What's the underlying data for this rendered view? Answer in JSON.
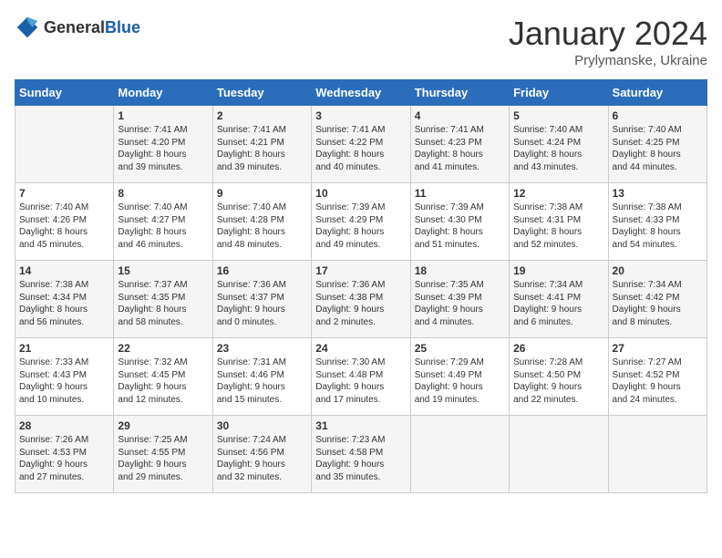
{
  "header": {
    "logo_general": "General",
    "logo_blue": "Blue",
    "month_title": "January 2024",
    "subtitle": "Prylymanske, Ukraine"
  },
  "weekdays": [
    "Sunday",
    "Monday",
    "Tuesday",
    "Wednesday",
    "Thursday",
    "Friday",
    "Saturday"
  ],
  "weeks": [
    [
      {
        "day": "",
        "content": ""
      },
      {
        "day": "1",
        "content": "Sunrise: 7:41 AM\nSunset: 4:20 PM\nDaylight: 8 hours\nand 39 minutes."
      },
      {
        "day": "2",
        "content": "Sunrise: 7:41 AM\nSunset: 4:21 PM\nDaylight: 8 hours\nand 39 minutes."
      },
      {
        "day": "3",
        "content": "Sunrise: 7:41 AM\nSunset: 4:22 PM\nDaylight: 8 hours\nand 40 minutes."
      },
      {
        "day": "4",
        "content": "Sunrise: 7:41 AM\nSunset: 4:23 PM\nDaylight: 8 hours\nand 41 minutes."
      },
      {
        "day": "5",
        "content": "Sunrise: 7:40 AM\nSunset: 4:24 PM\nDaylight: 8 hours\nand 43 minutes."
      },
      {
        "day": "6",
        "content": "Sunrise: 7:40 AM\nSunset: 4:25 PM\nDaylight: 8 hours\nand 44 minutes."
      }
    ],
    [
      {
        "day": "7",
        "content": "Sunrise: 7:40 AM\nSunset: 4:26 PM\nDaylight: 8 hours\nand 45 minutes."
      },
      {
        "day": "8",
        "content": "Sunrise: 7:40 AM\nSunset: 4:27 PM\nDaylight: 8 hours\nand 46 minutes."
      },
      {
        "day": "9",
        "content": "Sunrise: 7:40 AM\nSunset: 4:28 PM\nDaylight: 8 hours\nand 48 minutes."
      },
      {
        "day": "10",
        "content": "Sunrise: 7:39 AM\nSunset: 4:29 PM\nDaylight: 8 hours\nand 49 minutes."
      },
      {
        "day": "11",
        "content": "Sunrise: 7:39 AM\nSunset: 4:30 PM\nDaylight: 8 hours\nand 51 minutes."
      },
      {
        "day": "12",
        "content": "Sunrise: 7:38 AM\nSunset: 4:31 PM\nDaylight: 8 hours\nand 52 minutes."
      },
      {
        "day": "13",
        "content": "Sunrise: 7:38 AM\nSunset: 4:33 PM\nDaylight: 8 hours\nand 54 minutes."
      }
    ],
    [
      {
        "day": "14",
        "content": "Sunrise: 7:38 AM\nSunset: 4:34 PM\nDaylight: 8 hours\nand 56 minutes."
      },
      {
        "day": "15",
        "content": "Sunrise: 7:37 AM\nSunset: 4:35 PM\nDaylight: 8 hours\nand 58 minutes."
      },
      {
        "day": "16",
        "content": "Sunrise: 7:36 AM\nSunset: 4:37 PM\nDaylight: 9 hours\nand 0 minutes."
      },
      {
        "day": "17",
        "content": "Sunrise: 7:36 AM\nSunset: 4:38 PM\nDaylight: 9 hours\nand 2 minutes."
      },
      {
        "day": "18",
        "content": "Sunrise: 7:35 AM\nSunset: 4:39 PM\nDaylight: 9 hours\nand 4 minutes."
      },
      {
        "day": "19",
        "content": "Sunrise: 7:34 AM\nSunset: 4:41 PM\nDaylight: 9 hours\nand 6 minutes."
      },
      {
        "day": "20",
        "content": "Sunrise: 7:34 AM\nSunset: 4:42 PM\nDaylight: 9 hours\nand 8 minutes."
      }
    ],
    [
      {
        "day": "21",
        "content": "Sunrise: 7:33 AM\nSunset: 4:43 PM\nDaylight: 9 hours\nand 10 minutes."
      },
      {
        "day": "22",
        "content": "Sunrise: 7:32 AM\nSunset: 4:45 PM\nDaylight: 9 hours\nand 12 minutes."
      },
      {
        "day": "23",
        "content": "Sunrise: 7:31 AM\nSunset: 4:46 PM\nDaylight: 9 hours\nand 15 minutes."
      },
      {
        "day": "24",
        "content": "Sunrise: 7:30 AM\nSunset: 4:48 PM\nDaylight: 9 hours\nand 17 minutes."
      },
      {
        "day": "25",
        "content": "Sunrise: 7:29 AM\nSunset: 4:49 PM\nDaylight: 9 hours\nand 19 minutes."
      },
      {
        "day": "26",
        "content": "Sunrise: 7:28 AM\nSunset: 4:50 PM\nDaylight: 9 hours\nand 22 minutes."
      },
      {
        "day": "27",
        "content": "Sunrise: 7:27 AM\nSunset: 4:52 PM\nDaylight: 9 hours\nand 24 minutes."
      }
    ],
    [
      {
        "day": "28",
        "content": "Sunrise: 7:26 AM\nSunset: 4:53 PM\nDaylight: 9 hours\nand 27 minutes."
      },
      {
        "day": "29",
        "content": "Sunrise: 7:25 AM\nSunset: 4:55 PM\nDaylight: 9 hours\nand 29 minutes."
      },
      {
        "day": "30",
        "content": "Sunrise: 7:24 AM\nSunset: 4:56 PM\nDaylight: 9 hours\nand 32 minutes."
      },
      {
        "day": "31",
        "content": "Sunrise: 7:23 AM\nSunset: 4:58 PM\nDaylight: 9 hours\nand 35 minutes."
      },
      {
        "day": "",
        "content": ""
      },
      {
        "day": "",
        "content": ""
      },
      {
        "day": "",
        "content": ""
      }
    ]
  ]
}
